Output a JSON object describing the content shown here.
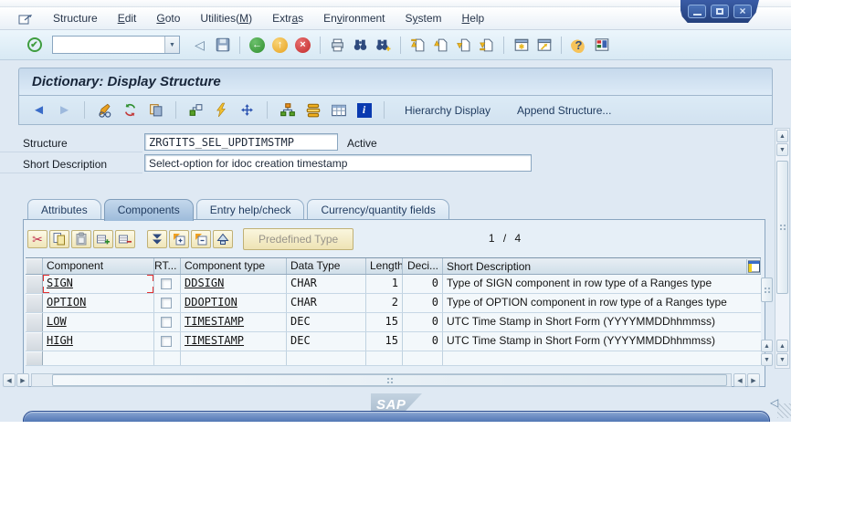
{
  "screen": {
    "title": "Dictionary: Display Structure"
  },
  "window_controls": {
    "minimize": "minimize-button",
    "maximize": "maximize-button",
    "close": "close-button"
  },
  "menu_bar": {
    "items": [
      {
        "pre": "Structure",
        "key": "",
        "post": ""
      },
      {
        "pre": "",
        "key": "E",
        "post": "dit"
      },
      {
        "pre": "",
        "key": "G",
        "post": "oto"
      },
      {
        "pre": "Utilities(",
        "key": "M",
        "post": ")"
      },
      {
        "pre": "Extr",
        "key": "a",
        "post": "s"
      },
      {
        "pre": "En",
        "key": "v",
        "post": "ironment"
      },
      {
        "pre": "S",
        "key": "y",
        "post": "stem"
      },
      {
        "pre": "",
        "key": "H",
        "post": "elp"
      }
    ]
  },
  "std_toolbar": {
    "command_value": ""
  },
  "app_toolbar": {
    "hierarchy_display": "Hierarchy Display",
    "append_structure": "Append Structure..."
  },
  "form": {
    "structure_label": "Structure",
    "structure_value": "ZRGTITS_SEL_UPDTIMSTMP",
    "status": "Active",
    "short_description_label": "Short Description",
    "short_description_value": "Select-option for idoc creation timestamp"
  },
  "tabs": [
    {
      "label": "Attributes",
      "active": false
    },
    {
      "label": "Components",
      "active": true
    },
    {
      "label": "Entry help/check",
      "active": false
    },
    {
      "label": "Currency/quantity fields",
      "active": false
    }
  ],
  "table_toolbar": {
    "predefined_type_label": "Predefined Type",
    "position_indicator": "1 / 4"
  },
  "table": {
    "headers": [
      "Component",
      "RT...",
      "Component type",
      "Data Type",
      "Length",
      "Deci...",
      "Short Description"
    ],
    "rows": [
      {
        "component": "SIGN",
        "rt_checked": false,
        "component_type": "DDSIGN",
        "data_type": "CHAR",
        "length": "1",
        "decimals": "0",
        "short_description": "Type of SIGN component in row type of a Ranges type"
      },
      {
        "component": "OPTION",
        "rt_checked": false,
        "component_type": "DDOPTION",
        "data_type": "CHAR",
        "length": "2",
        "decimals": "0",
        "short_description": "Type of OPTION component in row type of a Ranges type"
      },
      {
        "component": "LOW",
        "rt_checked": false,
        "component_type": "TIMESTAMP",
        "data_type": "DEC",
        "length": "15",
        "decimals": "0",
        "short_description": "UTC Time Stamp in Short Form (YYYYMMDDhhmmss)"
      },
      {
        "component": "HIGH",
        "rt_checked": false,
        "component_type": "TIMESTAMP",
        "data_type": "DEC",
        "length": "15",
        "decimals": "0",
        "short_description": "UTC Time Stamp in Short Form (YYYYMMDDhhmmss)"
      }
    ]
  },
  "footer": {
    "sap_logo": "SAP"
  },
  "icons": {
    "check": "✔",
    "dropdown": "▼",
    "back_triangle": "◁",
    "back_arrow": "←",
    "exit_arrow": "↑",
    "cancel_cross": "×",
    "question": "?",
    "info": "i",
    "scissors": "✂",
    "close": "×",
    "up": "▲",
    "down": "▼",
    "left": "◀",
    "right": "▶",
    "nav_back": "◄",
    "nav_forward": "►"
  },
  "colors": {
    "titlebar_top": "#c6d9ec",
    "titlebar_bottom": "#ddebf7",
    "active_tab": "#a9c3de",
    "table_button_bg": "#f2e9c2",
    "status_bar_blue": "#4d73b2",
    "window_tab_blue": "#2c4c8e",
    "disabled_text": "#98948a",
    "link_text": "#141414",
    "focus_frame_red": "#e23030"
  },
  "icon_names": [
    "system-menu-icon",
    "enter-icon",
    "dropdown-icon",
    "back-triangle-icon",
    "save-icon",
    "back-icon",
    "exit-icon",
    "cancel-icon",
    "print-icon",
    "find-icon",
    "find-next-icon",
    "first-page-icon",
    "prev-page-icon",
    "next-page-icon",
    "last-page-icon",
    "new-session-icon",
    "shortcut-icon",
    "help-icon",
    "customize-icon",
    "back-arrow-icon",
    "forward-arrow-icon",
    "display-change-icon",
    "refresh-icon",
    "copy-object-icon",
    "object-list-icon",
    "where-used-icon",
    "navigation-icon",
    "hierarchy-icon",
    "runtime-object-icon",
    "table-entries-icon",
    "info-icon",
    "cut-icon",
    "copy-icon",
    "paste-icon",
    "insert-row-icon",
    "delete-row-icon",
    "filter-icon",
    "expand-icon",
    "collapse-icon",
    "move-up-icon",
    "table-config-icon",
    "sap-logo",
    "status-collapse-icon",
    "resize-grip"
  ]
}
